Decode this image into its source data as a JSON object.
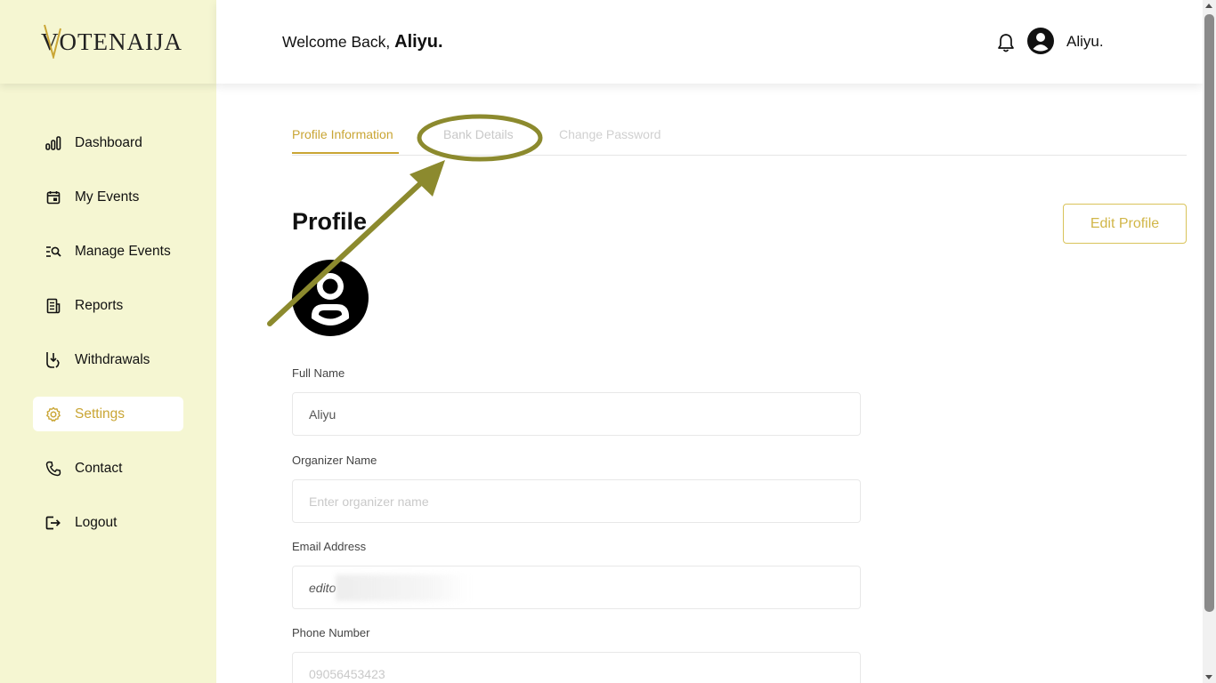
{
  "app": {
    "logo_first": "V",
    "logo_rest": "OTENAIJA"
  },
  "colors": {
    "accent": "#c9a534",
    "sidebar_bg": "#f5f6d2",
    "annotation": "#8c8a2e"
  },
  "sidebar": {
    "items": [
      {
        "label": "Dashboard",
        "icon": "bar-chart-icon"
      },
      {
        "label": "My Events",
        "icon": "calendar-icon"
      },
      {
        "label": "Manage Events",
        "icon": "list-search-icon"
      },
      {
        "label": "Reports",
        "icon": "document-icon"
      },
      {
        "label": "Withdrawals",
        "icon": "withdraw-icon"
      },
      {
        "label": "Settings",
        "icon": "gear-icon",
        "active": true
      },
      {
        "label": "Contact",
        "icon": "phone-icon"
      },
      {
        "label": "Logout",
        "icon": "logout-icon"
      }
    ]
  },
  "header": {
    "welcome_text": "Welcome Back,",
    "welcome_name": "Aliyu.",
    "user_name": "Aliyu."
  },
  "tabs": [
    {
      "label": "Profile Information",
      "active": true
    },
    {
      "label": "Bank Details",
      "active": false
    },
    {
      "label": "Change Password",
      "active": false
    }
  ],
  "profile": {
    "title": "Profile",
    "edit_button": "Edit Profile",
    "fields": {
      "full_name": {
        "label": "Full Name",
        "value": "Aliyu"
      },
      "organizer_name": {
        "label": "Organizer Name",
        "placeholder": "Enter organizer name"
      },
      "email": {
        "label": "Email Address",
        "value": "edito"
      },
      "phone": {
        "label": "Phone Number",
        "value": "09056453423"
      }
    }
  }
}
